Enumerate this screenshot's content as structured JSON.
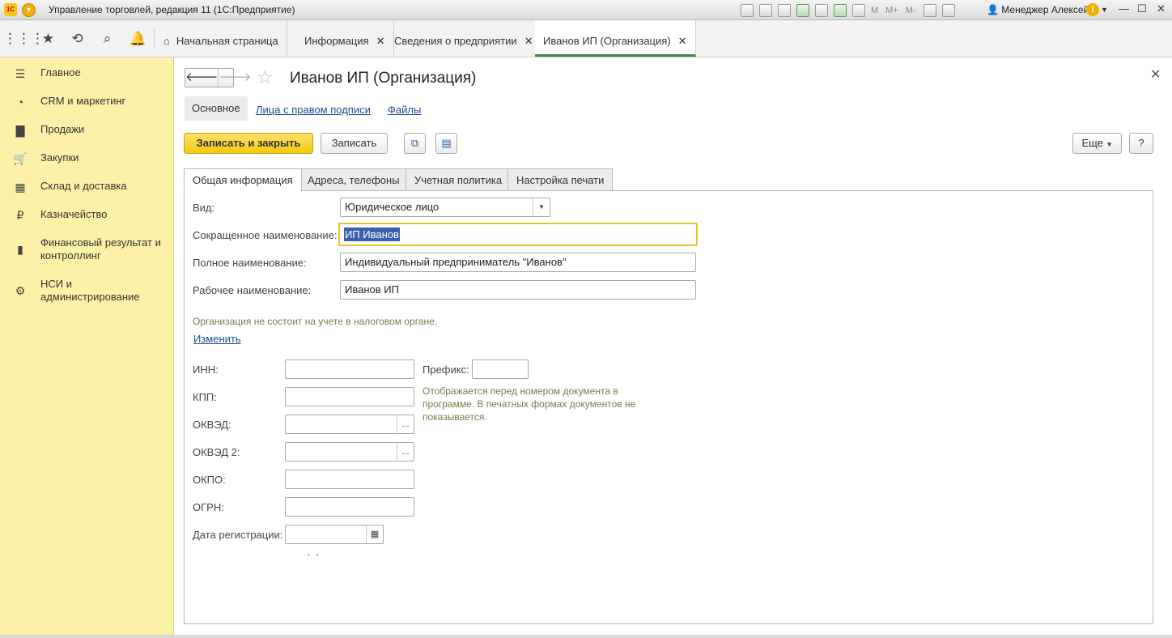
{
  "window": {
    "title": "Управление торговлей, редакция 11  (1С:Предприятие)",
    "user": "Менеджер Алексей",
    "memory_buttons": [
      "M",
      "M+",
      "M-"
    ],
    "logo_text": "1С"
  },
  "tabs": [
    {
      "label": "Начальная страница"
    },
    {
      "label": "Информация"
    },
    {
      "label": "Сведения о предприятии"
    },
    {
      "label": "Иванов ИП (Организация)"
    }
  ],
  "sidebar": {
    "items": [
      {
        "label": "Главное",
        "icon": "menu-icon"
      },
      {
        "label": "CRM и маркетинг",
        "icon": "pie-chart-icon"
      },
      {
        "label": "Продажи",
        "icon": "bag-icon"
      },
      {
        "label": "Закупки",
        "icon": "cart-icon"
      },
      {
        "label": "Склад и доставка",
        "icon": "warehouse-icon"
      },
      {
        "label": "Казначейство",
        "icon": "ruble-icon"
      },
      {
        "label": "Финансовый результат и контроллинг",
        "icon": "bar-chart-icon"
      },
      {
        "label": "НСИ и администрирование",
        "icon": "gear-icon"
      }
    ]
  },
  "form": {
    "title": "Иванов ИП (Организация)",
    "subnav": {
      "main": "Основное",
      "signers": "Лица с правом подписи",
      "files": "Файлы"
    },
    "toolbar": {
      "save_close": "Записать и закрыть",
      "save": "Записать",
      "more": "Еще",
      "help": "?"
    },
    "tabs": [
      "Общая информация",
      "Адреса, телефоны",
      "Учетная политика",
      "Настройка печати"
    ],
    "fields": {
      "kind_label": "Вид:",
      "kind_value": "Юридическое лицо",
      "short_name_label": "Сокращенное наименование:",
      "short_name_value": "ИП Иванов",
      "full_name_label": "Полное наименование:",
      "full_name_value": "Индивидуальный предприниматель \"Иванов\"",
      "work_name_label": "Рабочее наименование:",
      "work_name_value": "Иванов ИП",
      "tax_note": "Организация не состоит на учете в налоговом органе.",
      "change_link": "Изменить",
      "inn_label": "ИНН:",
      "prefix_label": "Префикс:",
      "prefix_hint": "Отображается перед номером документа в программе. В печатных формах документов не показывается.",
      "kpp_label": "КПП:",
      "okved_label": "ОКВЭД:",
      "okved2_label": "ОКВЭД 2:",
      "okpo_label": "ОКПО:",
      "ogrn_label": "ОГРН:",
      "reg_date_label": "Дата регистрации:",
      "reg_date_value": "  .  .",
      "picker_dots": "..."
    }
  }
}
